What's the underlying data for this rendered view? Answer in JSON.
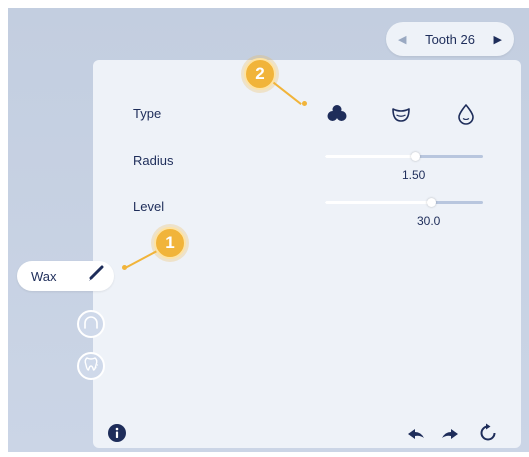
{
  "tooth_nav": {
    "label": "Tooth 26",
    "prev_icon": "triangle-left-icon",
    "next_icon": "triangle-right-icon"
  },
  "type_row": {
    "label": "Type",
    "options": [
      {
        "name": "blob-cluster-icon",
        "selected": true
      },
      {
        "name": "cup-shape-icon",
        "selected": false
      },
      {
        "name": "drop-shape-icon",
        "selected": false
      }
    ]
  },
  "radius": {
    "label": "Radius",
    "value": "1.50",
    "fraction": 0.57
  },
  "level": {
    "label": "Level",
    "value": "30.0",
    "fraction": 0.67
  },
  "callouts": {
    "one": "1",
    "two": "2"
  },
  "left_tools": {
    "wax": {
      "label": "Wax",
      "icon": "brush-icon"
    },
    "arch_icon": "arch-icon",
    "tooth_icon": "tooth-sparkle-icon"
  },
  "footer_icons": [
    "info-icon",
    "undo-icon",
    "redo-icon",
    "reset-icon"
  ],
  "colors": {
    "accent": "#1e2d5a",
    "callout": "#f1b43a",
    "panel": "#eef2f8",
    "background": "#c7d2e4"
  }
}
